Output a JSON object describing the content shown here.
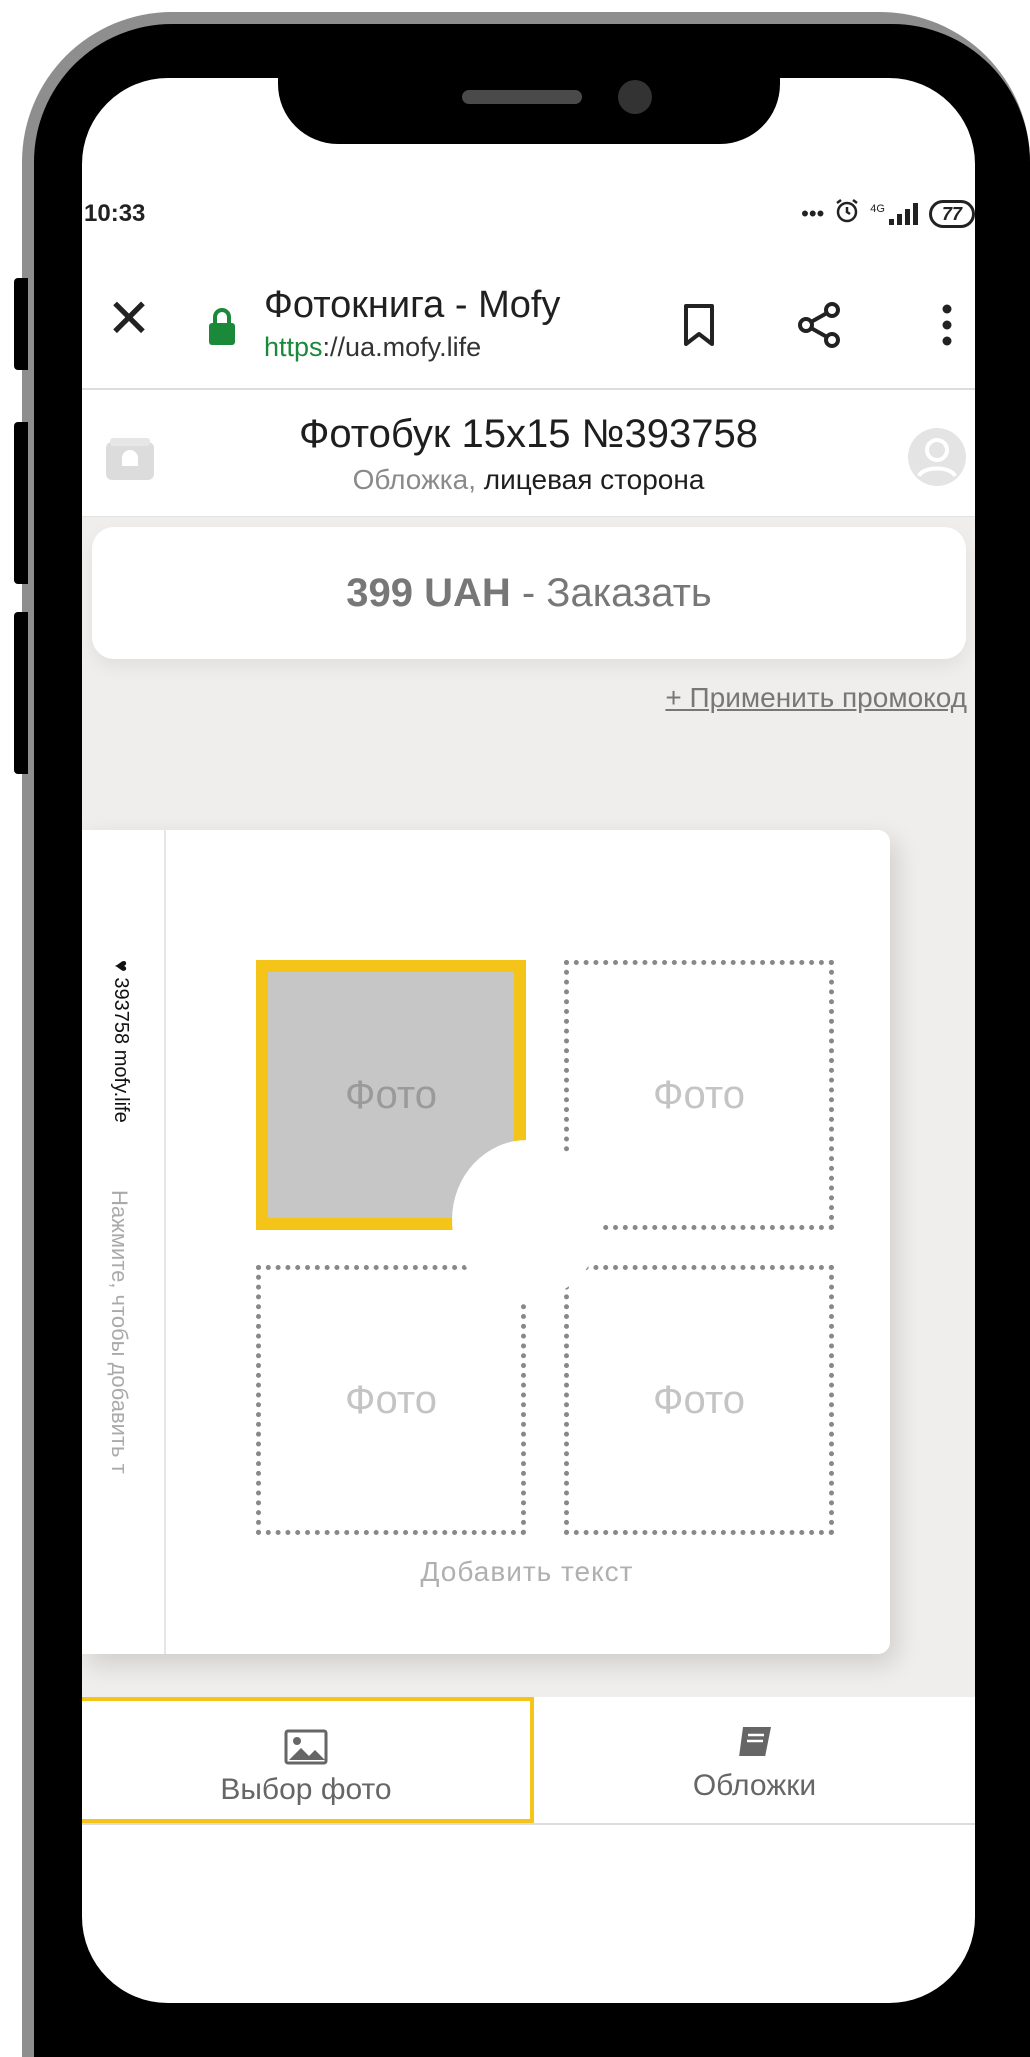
{
  "status_bar": {
    "time": "10:33",
    "dots": "•••",
    "network": "4G",
    "battery": "77"
  },
  "browser": {
    "title": "Фотокнига - Mofy",
    "url_scheme": "https",
    "url_rest": "://ua.mofy.life"
  },
  "header": {
    "title": "Фотобук 15x15 №393758",
    "subtitle_muted": "Обложка,",
    "subtitle_main": " лицевая сторона"
  },
  "order": {
    "price": "399 UAH",
    "action": " - Заказать"
  },
  "promo": {
    "label": "+ Применить промокод"
  },
  "spread": {
    "spine_text": "♥ 393758 mofy.life",
    "spine_hint": "Нажмите, чтобы добавить т",
    "slots": [
      "Фото",
      "Фото",
      "Фото",
      "Фото"
    ],
    "add_text": "Добавить текст"
  },
  "tabs": [
    {
      "label": "Выбор фото",
      "icon": "image-icon",
      "active": true
    },
    {
      "label": "Обложки",
      "icon": "book-icon",
      "active": false
    }
  ],
  "colors": {
    "accent": "#f4c518",
    "lock": "#1a8a3a",
    "canvas_bg": "#f0eeec"
  }
}
